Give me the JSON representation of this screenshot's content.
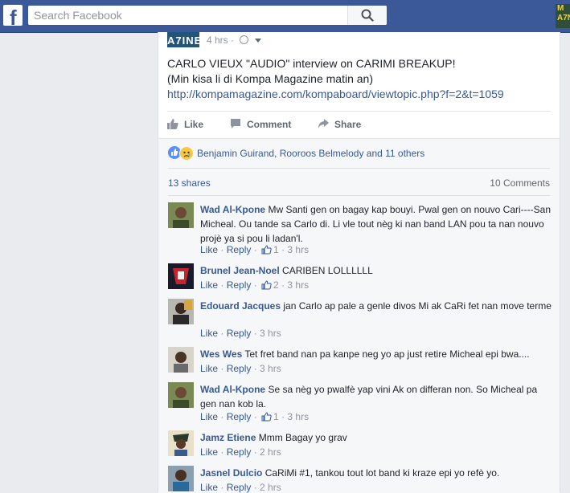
{
  "header": {
    "search_placeholder": "Search Facebook",
    "logo_letter": "f",
    "corner_thumb_text": "M\nA7N"
  },
  "post": {
    "page_thumb_text": "A7INE",
    "time": "4 hrs",
    "lines": [
      "CARLO VIEUX \"AUDIO\" interview on CARIMI BREAKUP!",
      "(Min kisa li di Kompa Magazine matin an)"
    ],
    "link": "http://kompamagazine.com/kompaboard/viewtopic.php?f=2&t=1059",
    "actions": {
      "like": "Like",
      "comment": "Comment",
      "share": "Share"
    }
  },
  "social": {
    "reactions_text": "Benjamin Guirand, Rooroos Belmelody and 11 others",
    "shares": "13 shares",
    "comments_count": "10 Comments"
  },
  "comments": [
    {
      "author": "Wad Al-Kpone",
      "text": "Mw Santi gen on bagay kap bouyi. Pwal gen on nouvo Cari----San Micheal. Ou tande sa Carlo di. Li vle tout nèg ki nan band LAN pou ta nan nouvo projè ya si pou li ladan'l.",
      "like": "Like",
      "reply": "Reply",
      "likes": "1",
      "time": "3 hrs"
    },
    {
      "author": "Brunel Jean-Noel",
      "text": "CARIBEN LOLLLLLL",
      "like": "Like",
      "reply": "Reply",
      "likes": "2",
      "time": "3 hrs"
    },
    {
      "author": "Edouard Jacques",
      "text": "jan Carlo ap pale a genle divos Mi ak CaRi fet nan move terme",
      "like": "Like",
      "reply": "Reply",
      "likes": "",
      "time": "3 hrs"
    },
    {
      "author": "Wes Wes",
      "text": "Tet fret band nan pa kanpe neg yo ap just retire Micheal epi bwa....",
      "like": "Like",
      "reply": "Reply",
      "likes": "",
      "time": "3 hrs"
    },
    {
      "author": "Wad Al-Kpone",
      "text": "Se sa nèg yo pwalfè yap vini Ak on differan non. So Micheal pa gen nan kob la.",
      "like": "Like",
      "reply": "Reply",
      "likes": "1",
      "time": "3 hrs"
    },
    {
      "author": "Jamz Etiene",
      "text": "Mmm Bagay yo grav",
      "like": "Like",
      "reply": "Reply",
      "likes": "",
      "time": "2 hrs"
    },
    {
      "author": "Jasnel Dulcio",
      "text": "CaRiMi #1, tankou tout lot band ki kraze epi yo refè yo.",
      "like": "Like",
      "reply": "Reply",
      "likes": "",
      "time": "2 hrs"
    }
  ]
}
